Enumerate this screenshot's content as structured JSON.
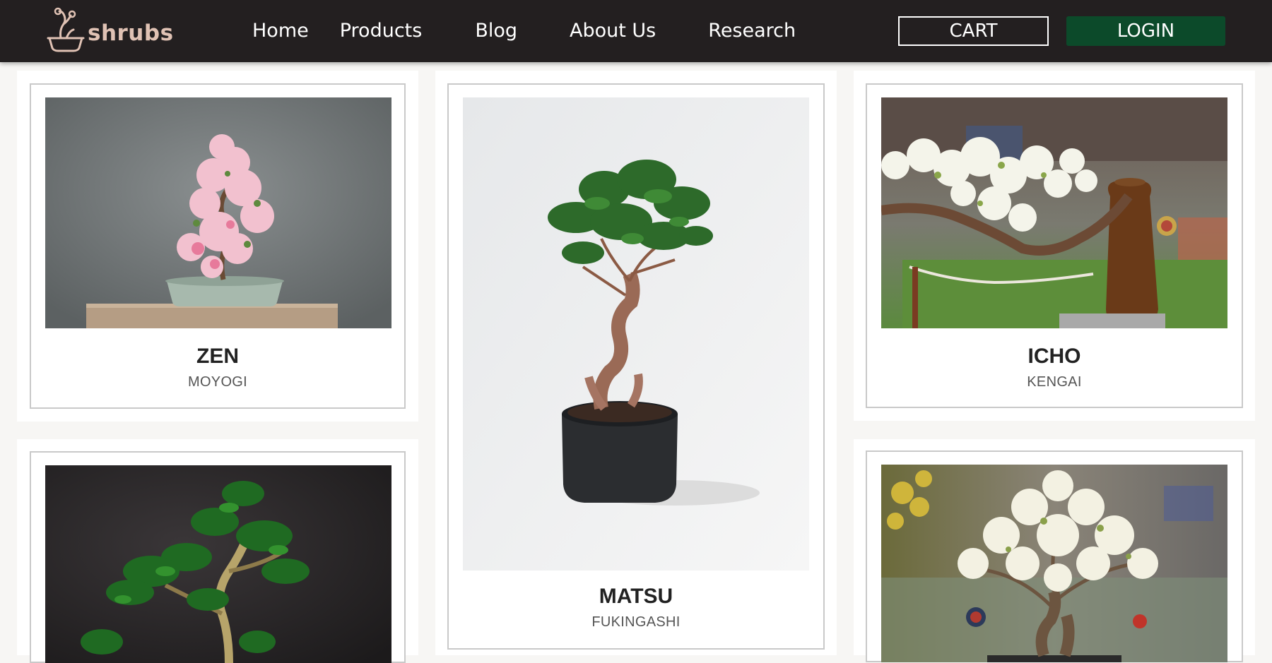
{
  "brand": {
    "name": "shrubs",
    "logo_icon": "bonsai-pot-icon",
    "color": "#e0c2b4"
  },
  "nav": {
    "home": "Home",
    "products": "Products",
    "blog": "Blog",
    "about": "About Us",
    "research": "Research"
  },
  "actions": {
    "cart": "CART",
    "login": "LOGIN",
    "login_color": "#0c4a2a"
  },
  "products": [
    {
      "name": "ZEN",
      "style": "MOYOGI"
    },
    {
      "name": "MATSU",
      "style": "FUKINGASHI"
    },
    {
      "name": "ICHO",
      "style": "KENGAI"
    }
  ]
}
